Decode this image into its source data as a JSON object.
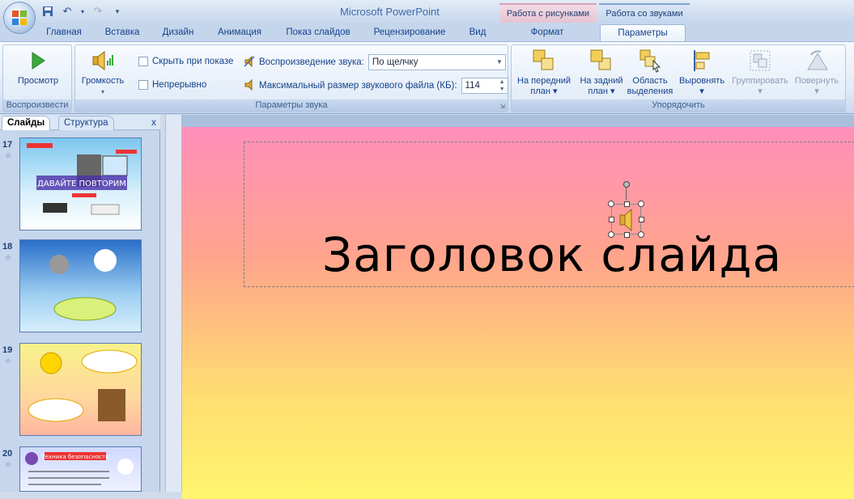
{
  "app": {
    "title": "Microsoft PowerPoint"
  },
  "context_tabs": {
    "picture": "Работа с рисунками",
    "sound": "Работа со звуками"
  },
  "tabs": [
    "Главная",
    "Вставка",
    "Дизайн",
    "Анимация",
    "Показ слайдов",
    "Рецензирование",
    "Вид",
    "Формат",
    "Параметры"
  ],
  "ribbon": {
    "play_group": {
      "label": "Воспроизвести",
      "preview": "Просмотр"
    },
    "sound_group": {
      "label": "Параметры звука",
      "volume": "Громкость",
      "hide_on_show": "Скрыть при показе",
      "loop": "Непрерывно",
      "play_sound_label": "Воспроизведение звука:",
      "play_sound_value": "По щелчку",
      "max_size_label": "Максимальный размер звукового файла (КБ):",
      "max_size_value": "114"
    },
    "arrange_group": {
      "label": "Упорядочить",
      "bring_front_1": "На передний",
      "bring_front_2": "план",
      "send_back_1": "На задний",
      "send_back_2": "план",
      "selection_1": "Область",
      "selection_2": "выделения",
      "align": "Выровнять",
      "group": "Группировать",
      "rotate": "Повернуть"
    }
  },
  "panel": {
    "tab_slides": "Слайды",
    "tab_outline": "Структура",
    "close": "x"
  },
  "slides": [
    {
      "num": "17",
      "text": "ДАВАЙТЕ ПОВТОРИМ"
    },
    {
      "num": "18",
      "text": ""
    },
    {
      "num": "19",
      "text": ""
    },
    {
      "num": "20",
      "text": "Техника безопасности"
    }
  ],
  "slide": {
    "title": "Заголовок слайда"
  }
}
